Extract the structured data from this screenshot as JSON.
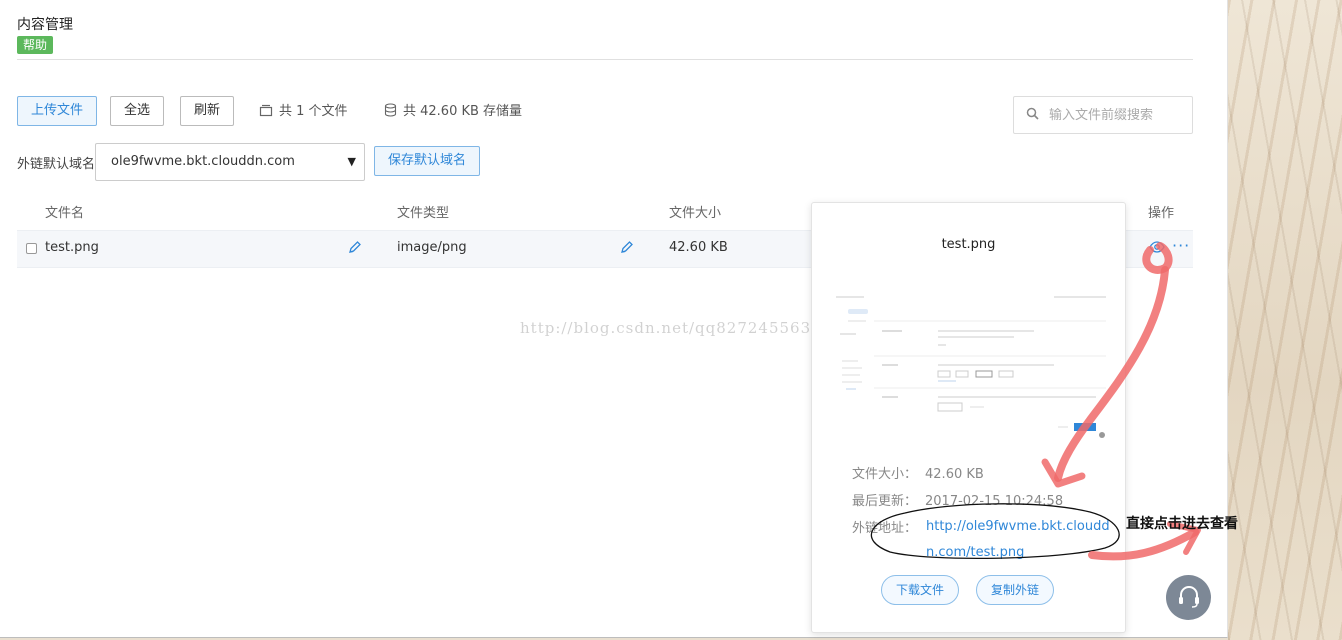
{
  "header": {
    "title": "内容管理",
    "help_badge": "帮助"
  },
  "toolbar": {
    "upload_label": "上传文件",
    "select_all_label": "全选",
    "refresh_label": "刷新",
    "file_count_text": "共 1 个文件",
    "storage_text": "共 42.60 KB 存储量",
    "search_placeholder": "输入文件前缀搜索"
  },
  "domain": {
    "label": "外链默认域名",
    "selected": "ole9fwvme.bkt.clouddn.com",
    "save_label": "保存默认域名"
  },
  "table": {
    "headers": {
      "name": "文件名",
      "type": "文件类型",
      "size": "文件大小",
      "ops": "操作"
    },
    "rows": [
      {
        "name": "test.png",
        "type": "image/png",
        "size": "42.60 KB"
      }
    ]
  },
  "popover": {
    "file_name": "test.png",
    "size_label": "文件大小：",
    "size_value": "42.60 KB",
    "updated_label": "最后更新：",
    "updated_value": "2017-02-15 10:24:58",
    "link_label": "外链地址：",
    "link_value": "http://ole9fwvme.bkt.clouddn.com/test.png",
    "download_label": "下载文件",
    "copy_link_label": "复制外链"
  },
  "watermark": "http://blog.csdn.net/qq827245563",
  "annotation": "直接点击进去查看",
  "icons": {
    "file_count": "stack-icon",
    "storage": "database-icon",
    "search": "search-icon",
    "edit": "pencil-icon",
    "preview": "eye-icon",
    "more": "ellipsis-icon",
    "support": "headset-icon"
  },
  "colors": {
    "accent": "#2f87d8",
    "help_badge": "#5cb85c",
    "annotation_arrow": "#f06a6a"
  }
}
